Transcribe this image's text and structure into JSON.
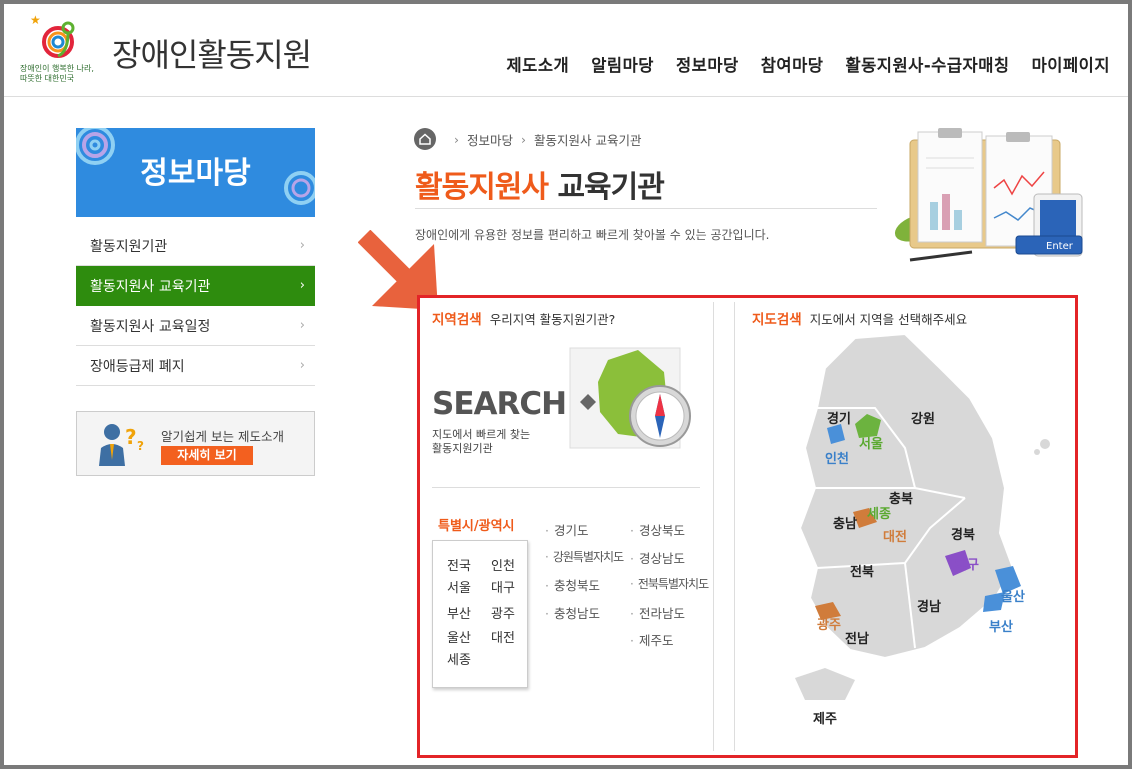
{
  "header": {
    "site_title": "장애인활동지원",
    "logo_tagline_1": "장애인이 행복한 나라,",
    "logo_tagline_2": "따뜻한 대한민국",
    "nav": [
      "제도소개",
      "알림마당",
      "정보마당",
      "참여마당",
      "활동지원사-수급자매칭",
      "마이페이지"
    ]
  },
  "sidebar": {
    "banner_title": "정보마당",
    "items": [
      {
        "label": "활동지원기관",
        "active": false
      },
      {
        "label": "활동지원사 교육기관",
        "active": true
      },
      {
        "label": "활동지원사 교육일정",
        "active": false
      },
      {
        "label": "장애등급제 폐지",
        "active": false
      }
    ],
    "promo_text": "알기쉽게 보는 제도소개",
    "promo_button": "자세히 보기"
  },
  "breadcrumb": [
    "정보마당",
    "활동지원사 교육기관"
  ],
  "page": {
    "title_highlight": "활동지원사",
    "title_rest": " 교육기관",
    "description": "장애인에게 유용한 정보를 편리하고 빠르게 찾아볼 수 있는 공간입니다.",
    "hero_enter_label": "Enter"
  },
  "region_search": {
    "heading": "지역검색",
    "subheading": "우리지역 활동지원기관?",
    "search_word": "SEARCH",
    "search_sub_1": "지도에서 빠르게 찾는",
    "search_sub_2": "활동지원기관",
    "metro_label": "특별시/광역시",
    "metro": [
      "전국",
      "인천",
      "서울",
      "대구",
      "부산",
      "광주",
      "울산",
      "대전",
      "세종"
    ],
    "provinces_col1": [
      "경기도",
      "강원특별자치도",
      "충청북도",
      "충청남도"
    ],
    "provinces_col2": [
      "경상북도",
      "경상남도",
      "전북특별자치도",
      "전라남도",
      "제주도"
    ]
  },
  "map_search": {
    "heading": "지도검색",
    "subheading": "지도에서 지역을 선택해주세요",
    "regions": [
      "경기",
      "강원",
      "서울",
      "인천",
      "충북",
      "세종",
      "충남",
      "대전",
      "경북",
      "대구",
      "전북",
      "울산",
      "경남",
      "부산",
      "광주",
      "전남",
      "제주"
    ]
  },
  "colors": {
    "accent_orange": "#ef5b1b",
    "active_green": "#2e8c0e",
    "banner_blue": "#2f8bdf",
    "highlight_red": "#e32428"
  }
}
